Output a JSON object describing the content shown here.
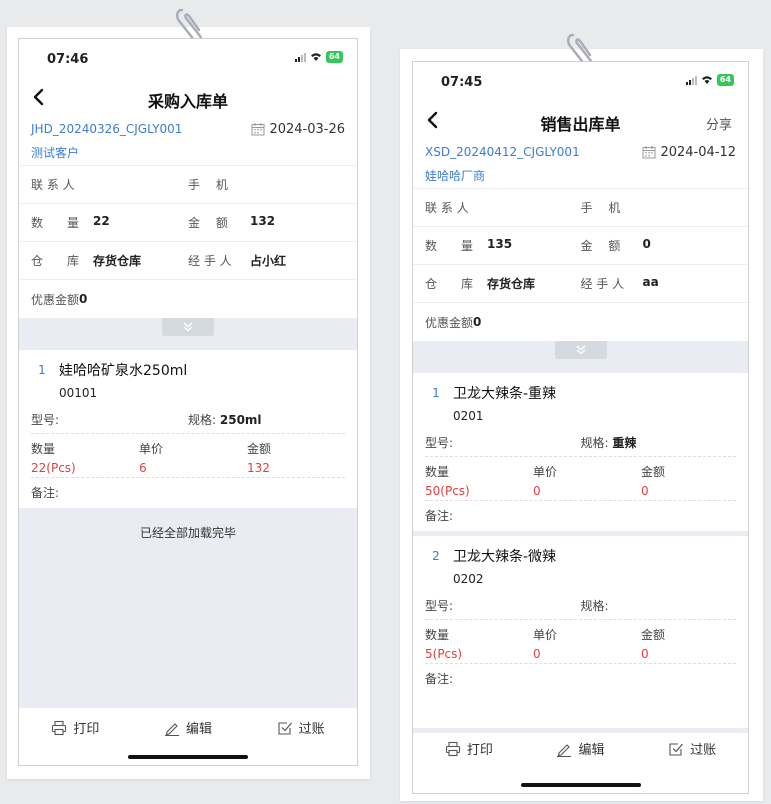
{
  "screens": [
    {
      "time": "07:46",
      "battery": "64",
      "title": "采购入库单",
      "share": "",
      "code": "JHD_20240326_CJGLY001",
      "date": "2024-03-26",
      "customer": "测试客户",
      "contact_label": "联 系 人",
      "phone_label": "手　 机",
      "qty_label": "数　　量",
      "qty": "22",
      "amount_label": "金　 额",
      "amount": "132",
      "warehouse_label": "仓　　库",
      "warehouse": "存货仓库",
      "handler_label": "经 手 人",
      "handler": "占小红",
      "discount_label": "优惠金额",
      "discount": "0",
      "items": [
        {
          "index": "1",
          "name": "娃哈哈矿泉水250ml",
          "code": "00101",
          "model_label": "型号:",
          "model": "",
          "spec_label": "规格:",
          "spec": "250ml",
          "qty_label": "数量",
          "qty": "22(Pcs)",
          "price_label": "单价",
          "price": "6",
          "amount_label": "金额",
          "amount": "132",
          "note_label": "备注:"
        }
      ],
      "loaded_text": "已经全部加载完毕",
      "footer": {
        "print": "打印",
        "edit": "编辑",
        "post": "过账"
      }
    },
    {
      "time": "07:45",
      "battery": "64",
      "title": "销售出库单",
      "share": "分享",
      "code": "XSD_20240412_CJGLY001",
      "date": "2024-04-12",
      "customer": "娃哈哈厂商",
      "contact_label": "联 系 人",
      "phone_label": "手　 机",
      "qty_label": "数　　量",
      "qty": "135",
      "amount_label": "金　 额",
      "amount": "0",
      "warehouse_label": "仓　　库",
      "warehouse": "存货仓库",
      "handler_label": "经 手 人",
      "handler": "aa",
      "discount_label": "优惠金额",
      "discount": "0",
      "items": [
        {
          "index": "1",
          "name": "卫龙大辣条-重辣",
          "code": "0201",
          "model_label": "型号:",
          "model": "",
          "spec_label": "规格:",
          "spec": "重辣",
          "qty_label": "数量",
          "qty": "50(Pcs)",
          "price_label": "单价",
          "price": "0",
          "amount_label": "金额",
          "amount": "0",
          "note_label": "备注:"
        },
        {
          "index": "2",
          "name": "卫龙大辣条-微辣",
          "code": "0202",
          "model_label": "型号:",
          "model": "",
          "spec_label": "规格:",
          "spec": "",
          "qty_label": "数量",
          "qty": "5(Pcs)",
          "price_label": "单价",
          "price": "0",
          "amount_label": "金额",
          "amount": "0",
          "note_label": "备注:"
        }
      ],
      "footer": {
        "print": "打印",
        "edit": "编辑",
        "post": "过账"
      }
    }
  ],
  "colors": {
    "link": "#3b7cd6",
    "value_red": "#e04040",
    "background": "#e9eaec",
    "section_bg": "#e9edf3"
  }
}
